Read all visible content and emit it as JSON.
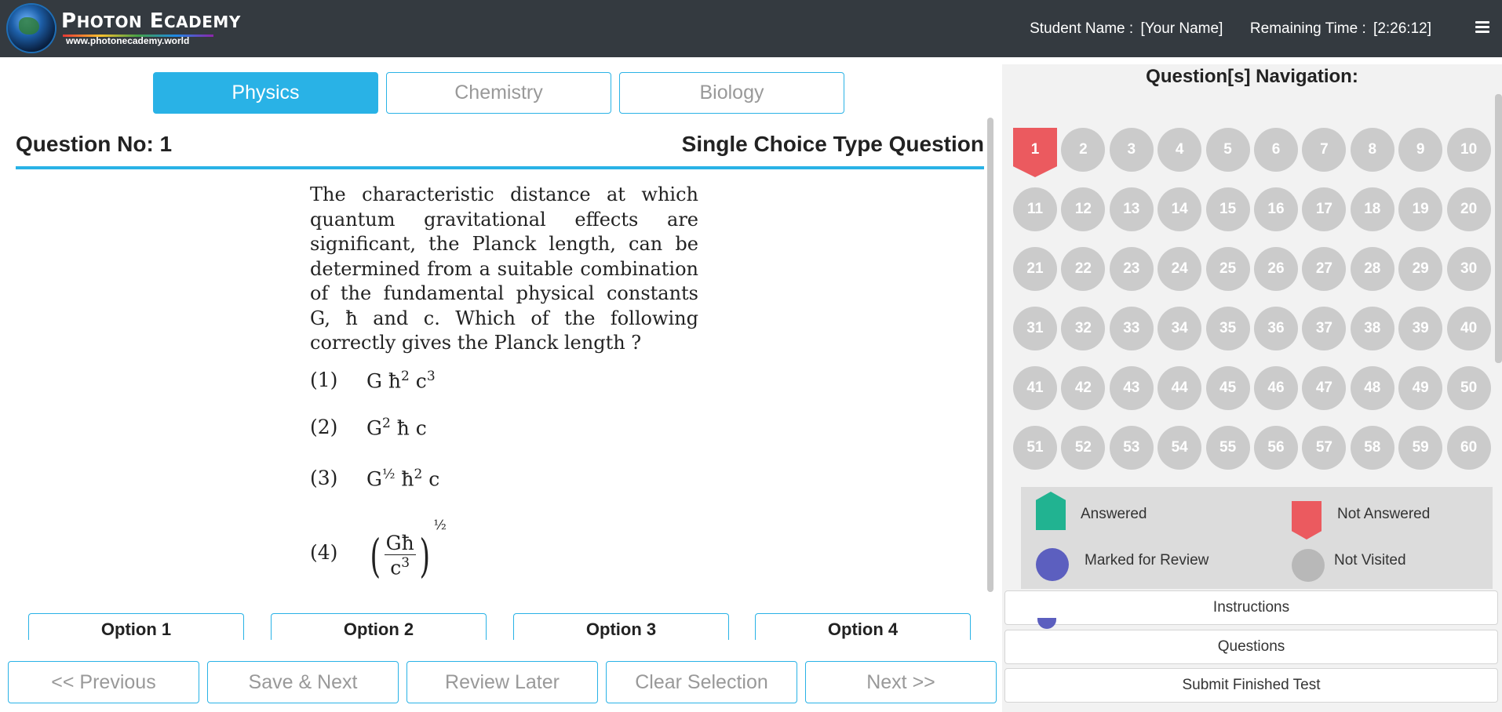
{
  "header": {
    "brand": "Photon Ecademy",
    "brand_url": "www.photonecademy.world",
    "student_label": "Student Name :",
    "student_name": "[Your Name]",
    "time_label": "Remaining Time :",
    "time_value": "[2:26:12]"
  },
  "subjects": [
    {
      "label": "Physics",
      "active": true
    },
    {
      "label": "Chemistry",
      "active": false
    },
    {
      "label": "Biology",
      "active": false
    }
  ],
  "question": {
    "number_label": "Question No: 1",
    "type_label": "Single Choice Type Question",
    "text": "The characteristic distance at which quantum gravitational effects are significant, the Planck length, can be determined from a suitable combination of the fundamental physical constants G, ħ and c. Which of the following correctly gives the Planck length ?",
    "options": [
      {
        "num": "(1)",
        "expr": "G ħ² c³"
      },
      {
        "num": "(2)",
        "expr": "G² ħ c"
      },
      {
        "num": "(3)",
        "expr": "G½ ħ² c"
      },
      {
        "num": "(4)",
        "expr": "(Għ / c³)½"
      }
    ]
  },
  "answer_buttons": [
    "Option 1",
    "Option 2",
    "Option 3",
    "Option 4"
  ],
  "nav_buttons": [
    "<< Previous",
    "Save & Next",
    "Review Later",
    "Clear Selection",
    "Next >>"
  ],
  "navigation": {
    "title": "Question[s] Navigation:",
    "current": "1",
    "questions": [
      "1",
      "2",
      "3",
      "4",
      "5",
      "6",
      "7",
      "8",
      "9",
      "10",
      "11",
      "12",
      "13",
      "14",
      "15",
      "16",
      "17",
      "18",
      "19",
      "20",
      "21",
      "22",
      "23",
      "24",
      "25",
      "26",
      "27",
      "28",
      "29",
      "30",
      "31",
      "32",
      "33",
      "34",
      "35",
      "36",
      "37",
      "38",
      "39",
      "40",
      "41",
      "42",
      "43",
      "44",
      "45",
      "46",
      "47",
      "48",
      "49",
      "50",
      "51",
      "52",
      "53",
      "54",
      "55",
      "56",
      "57",
      "58",
      "59",
      "60"
    ]
  },
  "legend": {
    "answered": "Answered",
    "not_answered": "Not Answered",
    "marked_for_review": "Marked for Review",
    "not_visited": "Not Visited"
  },
  "side_buttons": {
    "instructions": "Instructions",
    "questions": "Questions",
    "submit": "Submit Finished Test"
  },
  "colors": {
    "header_bg": "#343a40",
    "accent": "#29b2e6",
    "not_answered": "#eb5a5f",
    "answered": "#21b391",
    "review": "#5c5fbf",
    "not_visited": "#cbcbcb"
  }
}
